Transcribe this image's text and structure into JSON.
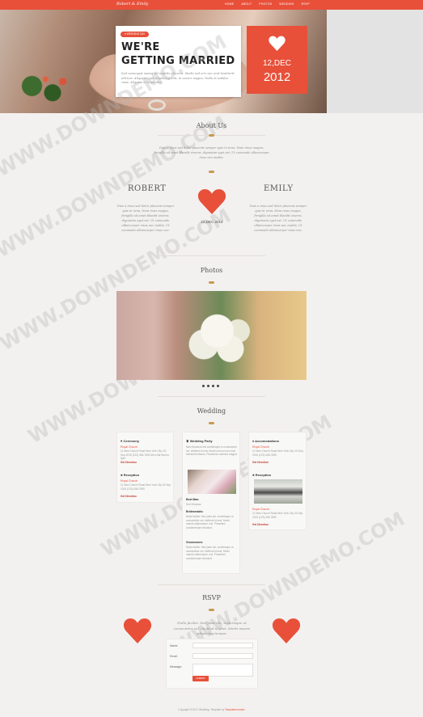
{
  "header": {
    "brand": "Robert & Emily",
    "nav": [
      "HOME",
      "ABOUT",
      "PHOTOS",
      "WEDDING",
      "RSVP"
    ]
  },
  "hero": {
    "badge": "♥ WEDDING DAY",
    "title_line1": "WE'RE",
    "title_line2": "GETTING MARRIED",
    "text": "Sed consequat massa vel sagittis placerat. Morbi sed orci nec erat hendrerit ultrices. Aliquam eget adipiscing erat, in auctor magna. Nulla et sodales risus. Aliquam et imperdiet.",
    "date_line": "12,DEC",
    "year": "2012"
  },
  "about": {
    "title": "About Us",
    "intro": "Duis a risus sed dolor placerat semper quis in urna. Nam risus magna, fringilla sit amet blandit viverra, dignissim eget est. Ut commodo ullamcorper risus nec mattis.",
    "groom_name": "ROBERT",
    "groom_text": "Duis a risus sed dolor placerat semper quis in urna. Nam risus magna, fringilla sit amet blandit viverra, dignissim eget est. Ut commodo ullamcorper risus nec mattis. Ut commodo ullamcorper risus nec.",
    "date": "12,DEC 2012",
    "bride_name": "EMILY",
    "bride_text": "Duis a risus sed dolor placerat semper quis in urna. Nam risus magna, fringilla sit amet blandit viverra, dignissim eget est. Ut commodo ullamcorper risus nec mattis. Ut commodo ullamcorper risus nec."
  },
  "photos": {
    "title": "Photos"
  },
  "wedding": {
    "title": "Wedding",
    "ceremony": {
      "heading": "Ceremony",
      "venue": "Royal Church",
      "address": "11 New Church Road New York City. 03-Sep-2015 (123) 456-7890 Mon-Sat 9am to 6pm",
      "link": "Get Direction"
    },
    "reception_left": {
      "heading": "Reception",
      "venue": "Royal Church",
      "address": "11 New Church Road New York City 03 Sep 2015 (123) 456-7890",
      "link": "Get Direction"
    },
    "party": {
      "heading": "Wedding Party",
      "text": "Nam tincidunt nisl scelerisque in consectetur vel, eleifend id erat. Morbi sed orci nec erat hendrerit ultrices. Phasellus euismod magna.",
      "label1": "Best Man:",
      "value1": "Sed Vivamus",
      "label2": "Bridesmaids:",
      "value2": "Nulla facilisi. Sed justo dui, scelerisque ut consectetur vel, eleifend id erat. Morbi mauris ullamcorper orci. Phasellus condimentum tincidunt.",
      "label3": "Groomsmen:",
      "value3": "Nulla facilisi. Sed justo dui, scelerisque ut consectetur vel, eleifend id erat. Morbi mauris ullamcorper orci. Phasellus condimentum tincidunt."
    },
    "accommodations": {
      "heading": "Accomodations",
      "venue": "Royal Church",
      "address": "11 New Church Road New York City. 03-Sep-2015 (123) 456-7890",
      "link": "Get Direction"
    },
    "reception_right": {
      "heading": "Reception",
      "venue": "Royal Church",
      "address": "11 New Church Road New York City 03-Sep-2015 (123) 456-7890",
      "link": "Get Direction"
    }
  },
  "rsvp": {
    "title": "RSVP",
    "text": "Nulla facilisi. Sed justo dui, scelerisque ut consectetur vel, eleifend id erat. Morbi mauris adipiscing tempor.",
    "label_name": "Name:",
    "label_email": "Email:",
    "label_message": "Message:",
    "submit": "SUBMIT"
  },
  "footer": {
    "text": "Copyright 2013 © Wedding. Template by ",
    "link": "Tamplatemonster"
  },
  "watermark": "WWW.DOWNDEMO.COM",
  "colors": {
    "accent": "#e8503a",
    "gold": "#c69a52",
    "background": "#f3f1ef"
  }
}
